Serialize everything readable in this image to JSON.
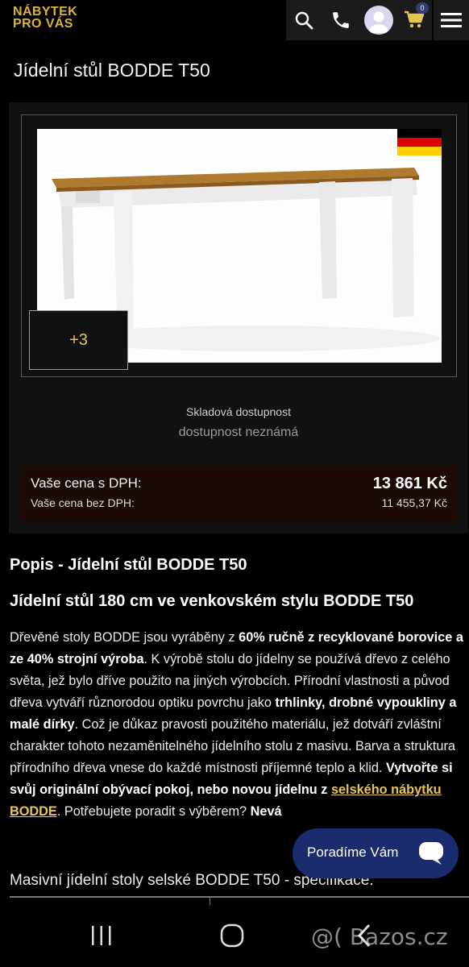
{
  "header": {
    "logo_line1": "NÁBYTEK",
    "logo_line2": "PRO VÁS",
    "cart_count": "0",
    "icons": [
      "search-icon",
      "phone-icon",
      "avatar",
      "cart-icon",
      "menu-icon"
    ]
  },
  "page": {
    "title": "Jídelní stůl BODDE T50"
  },
  "gallery": {
    "more_label": "+3",
    "flag": "germany-flag"
  },
  "stock": {
    "label": "Skladová dostupnost",
    "value": "dostupnost neznámá"
  },
  "price": {
    "with_vat_label": "Vaše cena s DPH:",
    "with_vat_value": "13 861 Kč",
    "without_vat_label": "Vaše cena bez DPH:",
    "without_vat_value": "11 455,37 Kč"
  },
  "description": {
    "title": "Popis - Jídelní stůl BODDE T50",
    "heading": "Jídelní stůl 180 cm ve venkovském stylu BODDE T50",
    "p1": "Dřevěné stoly BODDE jsou vyráběny z ",
    "b1": "60% ručně z recyklované borovice a ze 40% strojní výroba",
    "p2": ". K výrobě stolu do jídelny se používá dřevo z celého světa, jež bylo dříve použito na jiných výrobcích. Přírodní vlastnosti a původ dřeva vytváří různorodou optiku povrchu jako ",
    "b2": "trhlinky, drobné vypoukliny a malé dírky",
    "p3": ". Což je důkaz pravosti použitého materiálu, jež dotváří zvláštní charakter tohoto nezaměnitelného jídelního stolu z masivu. Barva a struktura přírodního dřeva vnese do každé místnosti příjemné teplo a klid. ",
    "b3": "Vytvořte si svůj originální obývací pokoj, nebo novou jídelnu z ",
    "link": "selského nábytku BODDE",
    "p4": ". Potřebujete poradit s výběrem? ",
    "b4": "Nevá",
    "spec_title": "Masivní jídelní stoly selské BODDE T50 - specifikace:"
  },
  "chat": {
    "label": "Poradíme Vám"
  },
  "watermark": "@( Bazos.cz",
  "colors": {
    "accent": "#e7c64f",
    "chat_bg": "#1a2c6e",
    "price_bg": "#1c0a06"
  }
}
